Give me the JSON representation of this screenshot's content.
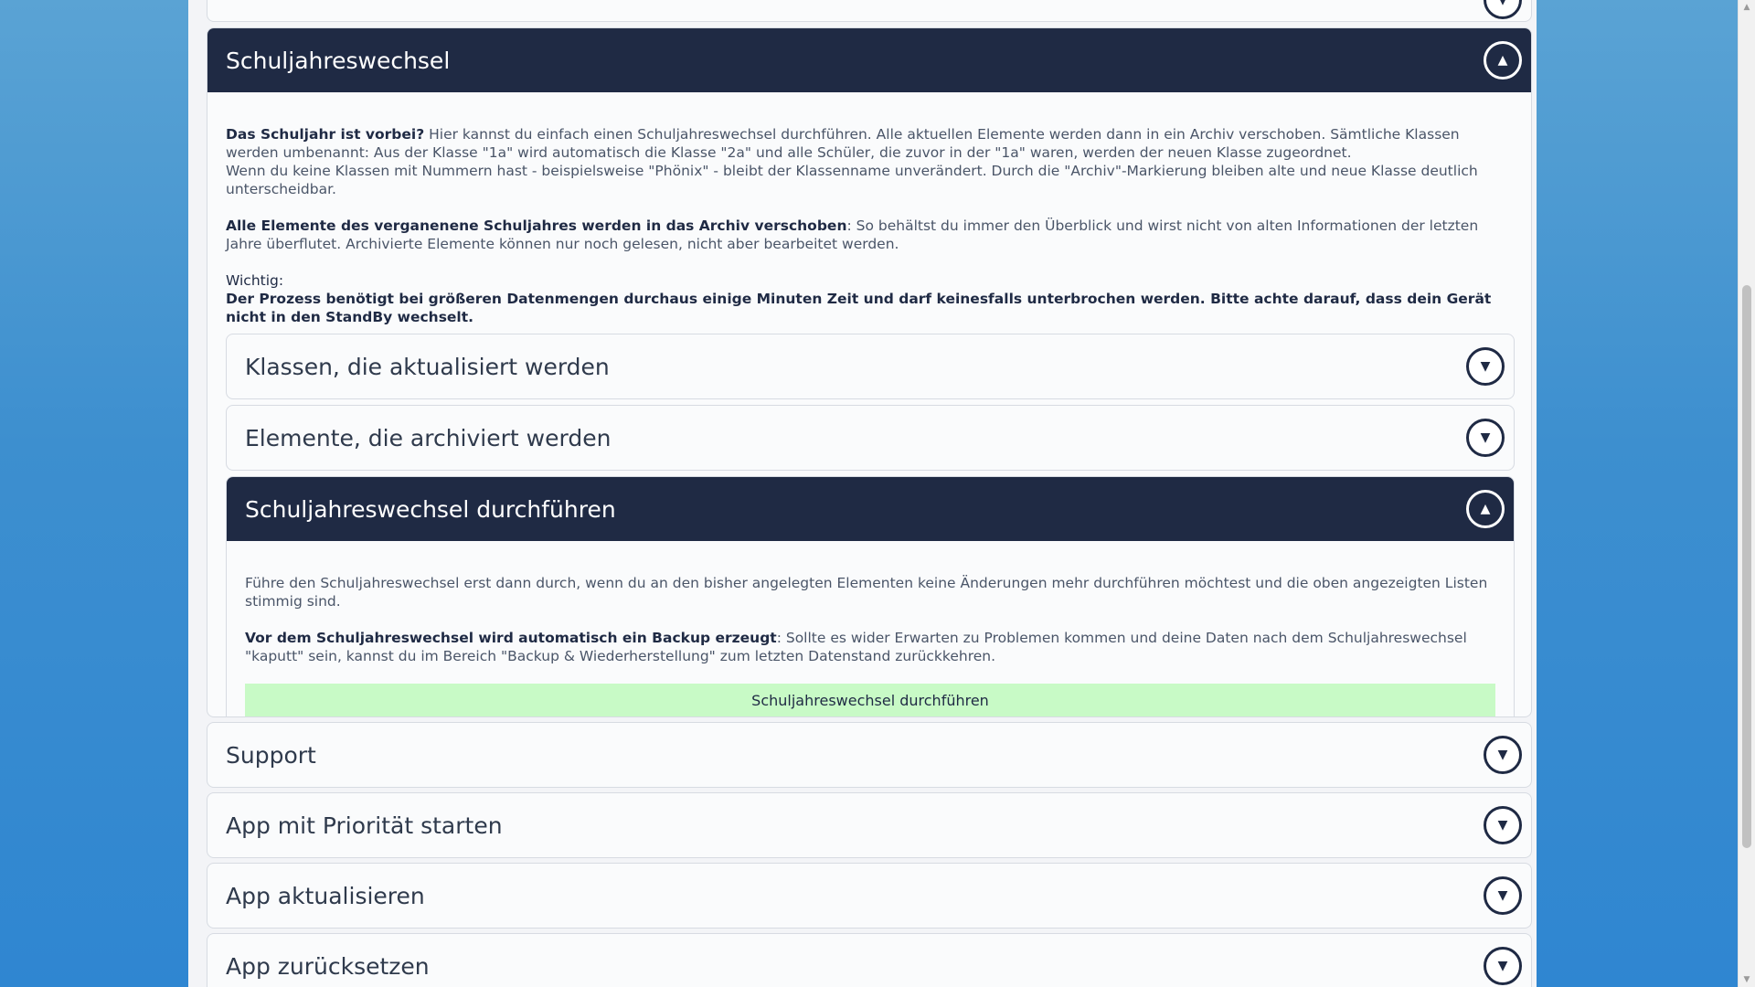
{
  "colors": {
    "navy": "#1f2a44",
    "green_button": "#c8fac6",
    "background": "#3d8fcf"
  },
  "schuljahr": {
    "title": "Schuljahreswechsel",
    "intro_bold": "Das Schuljahr ist vorbei?",
    "intro_text": " Hier kannst du einfach einen Schuljahreswechsel durchführen. Alle aktuellen Elemente werden dann in ein Archiv verschoben. Sämtliche Klassen werden umbenannt: Aus der Klasse \"1a\" wird automatisch die Klasse \"2a\" und alle Schüler, die zuvor in der \"1a\" waren, werden der neuen Klasse zugeordnet.",
    "intro_line2": "Wenn du keine Klassen mit Nummern hast - beispielsweise \"Phönix\" - bleibt der Klassenname unverändert. Durch die \"Archiv\"-Markierung bleiben alte und neue Klasse deutlich unterscheidbar.",
    "archive_bold": "Alle Elemente des verganenene Schuljahres werden in das Archiv verschoben",
    "archive_text": ": So behältst du immer den Überblick und wirst nicht von alten Informationen der letzten Jahre überflutet. Archivierte Elemente können nur noch gelesen, nicht aber bearbeitet werden.",
    "important_label": "Wichtig:",
    "important_text": "Der Prozess benötigt bei größeren Datenmengen durchaus einige Minuten Zeit und darf keinesfalls unterbrochen werden. Bitte achte darauf, dass dein Gerät nicht in den StandBy wechselt.",
    "sub_klassen": "Klassen, die aktualisiert werden",
    "sub_elemente": "Elemente, die archiviert werden",
    "sub_durchfuehren": "Schuljahreswechsel durchführen",
    "run_text": "Führe den Schuljahreswechsel erst dann durch, wenn du an den bisher angelegten Elementen keine Änderungen mehr durchführen möchtest und die oben angezeigten Listen stimmig sind.",
    "backup_bold": "Vor dem Schuljahreswechsel wird automatisch ein Backup erzeugt",
    "backup_text": ": Sollte es wider Erwarten zu Problemen kommen und deine Daten nach dem Schuljahreswechsel \"kaputt\" sein, kannst du im Bereich \"Backup & Wiederherstellung\" zum letzten Datenstand zurückkehren.",
    "run_button": "Schuljahreswechsel durchführen"
  },
  "sections": {
    "support": "Support",
    "prioritaet": "App mit Priorität starten",
    "aktualisieren": "App aktualisieren",
    "zuruecksetzen": "App zurücksetzen"
  },
  "icons": {
    "expand": "▼",
    "collapse": "▲"
  }
}
